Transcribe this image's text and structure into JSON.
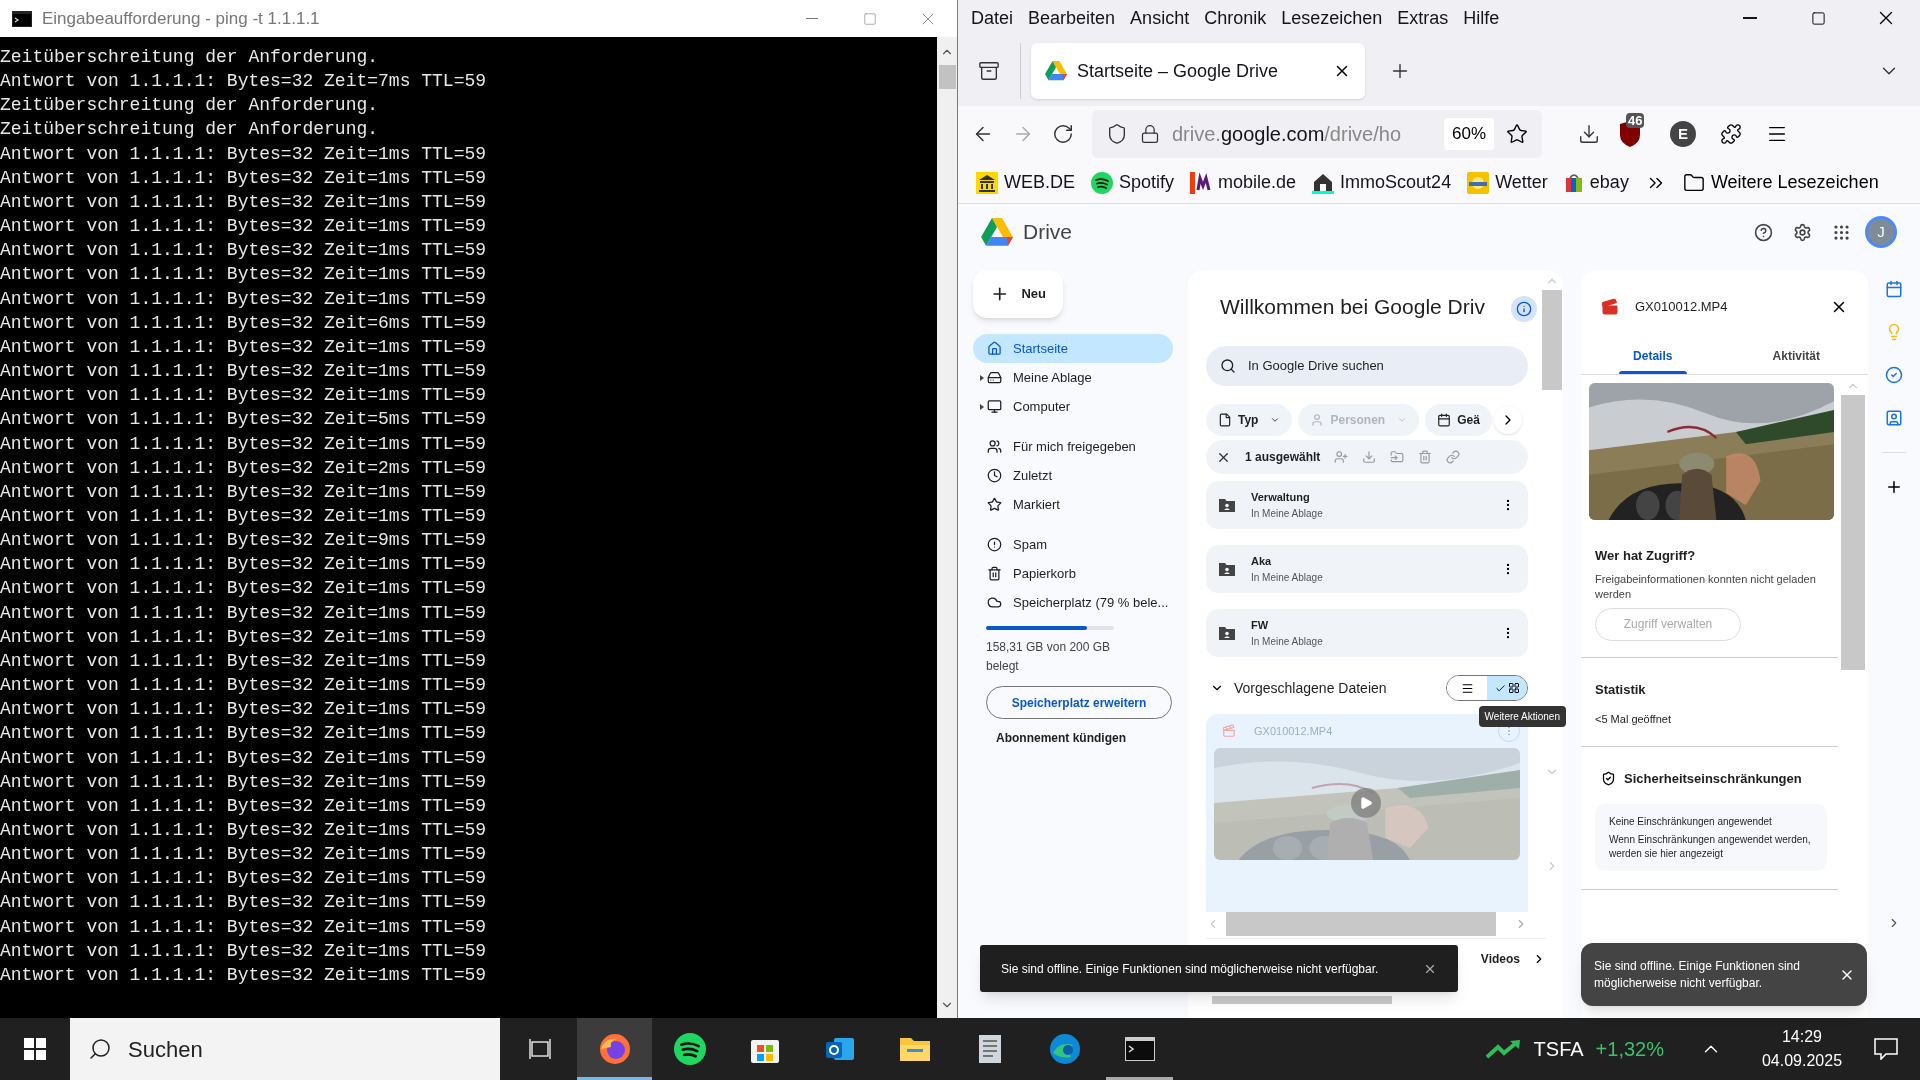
{
  "terminal": {
    "title": "Eingabeaufforderung - ping  -t 1.1.1.1",
    "lines": [
      "Zeitüberschreitung der Anforderung.",
      "Antwort von 1.1.1.1: Bytes=32 Zeit=7ms TTL=59",
      "Zeitüberschreitung der Anforderung.",
      "Zeitüberschreitung der Anforderung.",
      "Antwort von 1.1.1.1: Bytes=32 Zeit=1ms TTL=59",
      "Antwort von 1.1.1.1: Bytes=32 Zeit=1ms TTL=59",
      "Antwort von 1.1.1.1: Bytes=32 Zeit=1ms TTL=59",
      "Antwort von 1.1.1.1: Bytes=32 Zeit=1ms TTL=59",
      "Antwort von 1.1.1.1: Bytes=32 Zeit=1ms TTL=59",
      "Antwort von 1.1.1.1: Bytes=32 Zeit=1ms TTL=59",
      "Antwort von 1.1.1.1: Bytes=32 Zeit=1ms TTL=59",
      "Antwort von 1.1.1.1: Bytes=32 Zeit=6ms TTL=59",
      "Antwort von 1.1.1.1: Bytes=32 Zeit=1ms TTL=59",
      "Antwort von 1.1.1.1: Bytes=32 Zeit=1ms TTL=59",
      "Antwort von 1.1.1.1: Bytes=32 Zeit=1ms TTL=59",
      "Antwort von 1.1.1.1: Bytes=32 Zeit=5ms TTL=59",
      "Antwort von 1.1.1.1: Bytes=32 Zeit=1ms TTL=59",
      "Antwort von 1.1.1.1: Bytes=32 Zeit=2ms TTL=59",
      "Antwort von 1.1.1.1: Bytes=32 Zeit=1ms TTL=59",
      "Antwort von 1.1.1.1: Bytes=32 Zeit=1ms TTL=59",
      "Antwort von 1.1.1.1: Bytes=32 Zeit=9ms TTL=59",
      "Antwort von 1.1.1.1: Bytes=32 Zeit=1ms TTL=59",
      "Antwort von 1.1.1.1: Bytes=32 Zeit=1ms TTL=59",
      "Antwort von 1.1.1.1: Bytes=32 Zeit=1ms TTL=59",
      "Antwort von 1.1.1.1: Bytes=32 Zeit=1ms TTL=59",
      "Antwort von 1.1.1.1: Bytes=32 Zeit=1ms TTL=59",
      "Antwort von 1.1.1.1: Bytes=32 Zeit=1ms TTL=59",
      "Antwort von 1.1.1.1: Bytes=32 Zeit=1ms TTL=59",
      "Antwort von 1.1.1.1: Bytes=32 Zeit=1ms TTL=59",
      "Antwort von 1.1.1.1: Bytes=32 Zeit=1ms TTL=59",
      "Antwort von 1.1.1.1: Bytes=32 Zeit=1ms TTL=59",
      "Antwort von 1.1.1.1: Bytes=32 Zeit=1ms TTL=59",
      "Antwort von 1.1.1.1: Bytes=32 Zeit=1ms TTL=59",
      "Antwort von 1.1.1.1: Bytes=32 Zeit=1ms TTL=59",
      "Antwort von 1.1.1.1: Bytes=32 Zeit=1ms TTL=59",
      "Antwort von 1.1.1.1: Bytes=32 Zeit=1ms TTL=59",
      "Antwort von 1.1.1.1: Bytes=32 Zeit=1ms TTL=59",
      "Antwort von 1.1.1.1: Bytes=32 Zeit=1ms TTL=59",
      "Antwort von 1.1.1.1: Bytes=32 Zeit=1ms TTL=59"
    ]
  },
  "browser": {
    "menu": [
      "Datei",
      "Bearbeiten",
      "Ansicht",
      "Chronik",
      "Lesezeichen",
      "Extras",
      "Hilfe"
    ],
    "tab": {
      "title": "Startseite – Google Drive"
    },
    "forward": {
      "disabled": true
    },
    "url": {
      "prefix": "drive.",
      "domain": "google.com",
      "path": "/drive/ho"
    },
    "zoom": "60%",
    "extension_badge": "46",
    "profile": "E",
    "bookmarks": [
      {
        "label": "WEB.DE",
        "kind": "building"
      },
      {
        "label": "Spotify",
        "kind": "waves"
      },
      {
        "label": "mobile.de",
        "kind": "tile"
      },
      {
        "label": "ImmoScout24",
        "kind": "house"
      },
      {
        "label": "Wetter",
        "kind": "sun"
      },
      {
        "label": "ebay",
        "kind": "bag"
      }
    ],
    "more_bookmarks": "Weitere Lesezeichen"
  },
  "drive": {
    "logo": "Drive",
    "avatar": "J",
    "new_button": "Neu",
    "nav_groups": [
      [
        {
          "label": "Startseite",
          "selected": true,
          "expandable": false
        },
        {
          "label": "Meine Ablage",
          "selected": false,
          "expandable": true
        },
        {
          "label": "Computer",
          "selected": false,
          "expandable": true
        }
      ],
      [
        {
          "label": "Für mich freigegeben",
          "selected": false,
          "expandable": false
        },
        {
          "label": "Zuletzt",
          "selected": false,
          "expandable": false
        },
        {
          "label": "Markiert",
          "selected": false,
          "expandable": false
        }
      ],
      [
        {
          "label": "Spam",
          "selected": false,
          "expandable": false
        },
        {
          "label": "Papierkorb",
          "selected": false,
          "expandable": false
        },
        {
          "label": "Speicherplatz (79 % bele...",
          "selected": false,
          "expandable": false
        }
      ]
    ],
    "storage": {
      "level": 0.79,
      "usage": "158,31 GB von 200 GB belegt",
      "upgrade": "Speicherplatz erweitern",
      "cancel": "Abonnement kündigen"
    },
    "main": {
      "title": "Willkommen bei Google Driv",
      "search": {
        "placeholder": "In Google Drive suchen"
      },
      "chips": [
        {
          "label": "Typ",
          "disabled": false
        },
        {
          "label": "Personen",
          "disabled": true
        },
        {
          "label": "Geä",
          "disabled": false
        }
      ],
      "selection": "1 ausgewählt",
      "folders": [
        {
          "name": "Verwaltung",
          "location": "In Meine Ablage"
        },
        {
          "name": "Aka",
          "location": "In Meine Ablage"
        },
        {
          "name": "FW",
          "location": "In Meine Ablage"
        }
      ],
      "suggested": {
        "title": "Vorgeschlagene Dateien",
        "views": [
          {
            "kind": "list",
            "selected": false
          },
          {
            "kind": "grid",
            "selected": true
          }
        ],
        "tooltip": "Weitere Aktionen",
        "file": {
          "name": "GX010012.MP4",
          "kind": "picture"
        }
      },
      "filter_label": "Videos"
    },
    "details": {
      "file": "GX010012.MP4",
      "tabs": [
        {
          "label": "Details",
          "selected": true
        },
        {
          "label": "Aktivität",
          "selected": false
        }
      ],
      "access_title": "Wer hat Zugriff?",
      "access_note": "Freigabeinformationen konnten nicht geladen werden",
      "access_button": {
        "label": "Zugriff verwalten",
        "disabled": true
      },
      "stats_title": "Statistik",
      "stats_value": "<5 Mal geöffnet",
      "security_title": "Sicherheitseinschränkungen",
      "security_box_title": "Keine Einschränkungen angewendet",
      "security_box_text": "Wenn Einschränkungen angewendet werden, werden sie hier angezeigt"
    },
    "snackbars": [
      "Sie sind offline. Einige Funktionen sind möglicherweise nicht verfügbar.",
      "Sie sind offline. Einige Funktionen sind möglicherweise nicht verfügbar."
    ]
  },
  "taskbar": {
    "search": {
      "placeholder": "Suchen"
    },
    "apps": [
      {
        "kind": "taskview",
        "open": false,
        "focused": false
      },
      {
        "kind": "firefox",
        "open": true,
        "focused": true
      },
      {
        "kind": "spotify",
        "open": false,
        "focused": false
      },
      {
        "kind": "store",
        "open": false,
        "focused": false
      },
      {
        "kind": "mail",
        "open": false,
        "focused": false
      },
      {
        "kind": "explorer",
        "open": false,
        "focused": false
      },
      {
        "kind": "notes",
        "open": false,
        "focused": false
      },
      {
        "kind": "edge",
        "open": false,
        "focused": false
      },
      {
        "kind": "terminal",
        "open": true,
        "focused": false
      }
    ],
    "stock": {
      "symbol": "TSFA",
      "change": "+1,32%"
    },
    "time": "14:29",
    "date": "04.09.2025"
  }
}
